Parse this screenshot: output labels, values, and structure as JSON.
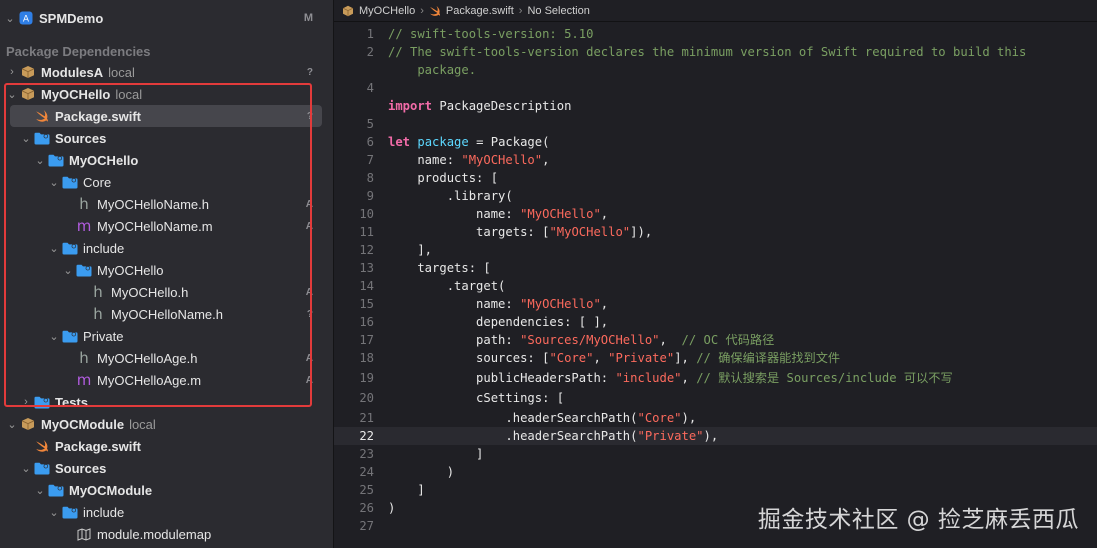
{
  "navigator": {
    "project": {
      "name": "SPMDemo",
      "status": "M"
    },
    "section_title": "Package Dependencies",
    "items": [
      {
        "label": "ModulesA",
        "suffix": "local",
        "status": "?"
      },
      {
        "label": "MyOCHello",
        "suffix": "local"
      },
      {
        "label": "Package.swift",
        "status": "?"
      },
      {
        "label": "Sources"
      },
      {
        "label": "MyOCHello"
      },
      {
        "label": "Core"
      },
      {
        "label": "MyOCHelloName.h",
        "status": "A"
      },
      {
        "label": "MyOCHelloName.m",
        "status": "A"
      },
      {
        "label": "include"
      },
      {
        "label": "MyOCHello"
      },
      {
        "label": "MyOCHello.h",
        "status": "A"
      },
      {
        "label": "MyOCHelloName.h",
        "status": "?"
      },
      {
        "label": "Private"
      },
      {
        "label": "MyOCHelloAge.h",
        "status": "A"
      },
      {
        "label": "MyOCHelloAge.m",
        "status": "A"
      },
      {
        "label": "Tests"
      },
      {
        "label": "MyOCModule",
        "suffix": "local"
      },
      {
        "label": "Package.swift"
      },
      {
        "label": "Sources"
      },
      {
        "label": "MyOCModule"
      },
      {
        "label": "include"
      },
      {
        "label": "module.modulemap"
      }
    ]
  },
  "breadcrumb": {
    "items": [
      "MyOCHello",
      "Package.swift",
      "No Selection"
    ]
  },
  "editor": {
    "current_line": 22,
    "lines": [
      [
        {
          "t": "// swift-tools-version: 5.10",
          "c": "com"
        }
      ],
      [
        {
          "t": "// The swift-tools-version declares the minimum version of Swift required to build this",
          "c": "com"
        }
      ],
      [
        {
          "t": "    package.",
          "c": "com"
        }
      ],
      [],
      [
        {
          "t": "import",
          "c": "key"
        },
        {
          "t": " PackageDescription"
        }
      ],
      [],
      [
        {
          "t": "let",
          "c": "key"
        },
        {
          "t": " "
        },
        {
          "t": "package",
          "c": "decl"
        },
        {
          "t": " = Package("
        }
      ],
      [
        {
          "t": "    name: "
        },
        {
          "t": "\"MyOCHello\"",
          "c": "str"
        },
        {
          "t": ","
        }
      ],
      [
        {
          "t": "    products: ["
        }
      ],
      [
        {
          "t": "        .library("
        }
      ],
      [
        {
          "t": "            name: "
        },
        {
          "t": "\"MyOCHello\"",
          "c": "str"
        },
        {
          "t": ","
        }
      ],
      [
        {
          "t": "            targets: ["
        },
        {
          "t": "\"MyOCHello\"",
          "c": "str"
        },
        {
          "t": "]),"
        }
      ],
      [
        {
          "t": "    ],"
        }
      ],
      [
        {
          "t": "    targets: ["
        }
      ],
      [
        {
          "t": "        .target("
        }
      ],
      [
        {
          "t": "            name: "
        },
        {
          "t": "\"MyOCHello\"",
          "c": "str"
        },
        {
          "t": ","
        }
      ],
      [
        {
          "t": "            dependencies: [ ],"
        }
      ],
      [
        {
          "t": "            path: "
        },
        {
          "t": "\"Sources/MyOCHello\"",
          "c": "str"
        },
        {
          "t": ",  "
        },
        {
          "t": "// OC 代码路径",
          "c": "com"
        }
      ],
      [
        {
          "t": "            sources: ["
        },
        {
          "t": "\"Core\"",
          "c": "str"
        },
        {
          "t": ", "
        },
        {
          "t": "\"Private\"",
          "c": "str"
        },
        {
          "t": "], "
        },
        {
          "t": "// 确保编译器能找到文件",
          "c": "com"
        }
      ],
      [
        {
          "t": "            publicHeadersPath: "
        },
        {
          "t": "\"include\"",
          "c": "str"
        },
        {
          "t": ", "
        },
        {
          "t": "// 默认搜索是 Sources/include 可以不写",
          "c": "com"
        }
      ],
      [
        {
          "t": "            cSettings: ["
        }
      ],
      [
        {
          "t": "                .headerSearchPath("
        },
        {
          "t": "\"Core\"",
          "c": "str"
        },
        {
          "t": "),"
        }
      ],
      [
        {
          "t": "                .headerSearchPath("
        },
        {
          "t": "\"Private\"",
          "c": "str"
        },
        {
          "t": "),"
        }
      ],
      [
        {
          "t": "            ]"
        }
      ],
      [
        {
          "t": "        )"
        }
      ],
      [
        {
          "t": "    ]"
        }
      ],
      [
        {
          "t": ")"
        }
      ],
      []
    ],
    "line_numbers": [
      "1",
      "2",
      "",
      "4",
      "",
      "5",
      "6",
      "7",
      "8",
      "9",
      "10",
      "11",
      "12",
      "13",
      "14",
      "15",
      "16",
      "17",
      "18",
      "19",
      "20",
      "21",
      "22",
      "23",
      "24",
      "25",
      "26",
      "27"
    ]
  },
  "watermark": "掘金技术社区 @ 捡芝麻丢西瓜",
  "colors": {
    "highlight_border": "#e33b3b",
    "folder": "#3b9cf0",
    "swift": "#f0863b",
    "package": "#c89b5a",
    "m_file": "#b15cde"
  }
}
